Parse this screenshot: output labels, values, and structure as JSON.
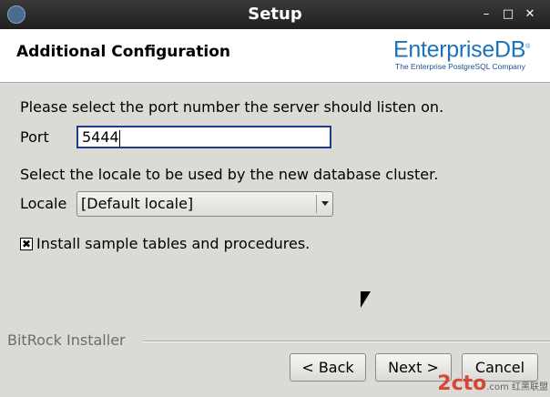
{
  "window": {
    "title": "Setup",
    "minimize": "–",
    "maximize": "□",
    "close": "✕"
  },
  "header": {
    "title": "Additional Configuration",
    "logo_enterprise": "Enterprise",
    "logo_db": "DB",
    "logo_reg": "®",
    "logo_tagline": "The Enterprise PostgreSQL Company"
  },
  "port": {
    "prompt": "Please select the port number the server should listen on.",
    "label": "Port",
    "value": "5444"
  },
  "locale": {
    "prompt": "Select the locale to be used by the new database cluster.",
    "label": "Locale",
    "selected": "[Default locale]"
  },
  "sample": {
    "checked": true,
    "check_glyph": "✖",
    "label": "Install sample tables and procedures."
  },
  "footer": {
    "installer_label": "BitRock Installer"
  },
  "buttons": {
    "back": "< Back",
    "next": "Next >",
    "cancel": "Cancel"
  },
  "watermark": {
    "brand": "2cto",
    "sub": ".com 红黑联盟"
  }
}
